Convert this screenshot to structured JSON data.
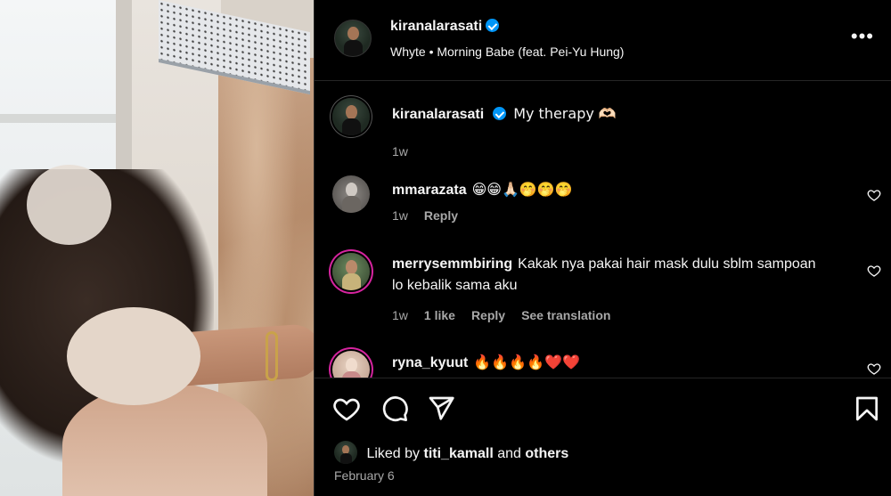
{
  "post": {
    "author": "kiranalarasati",
    "audio": "Whyte • Morning Babe (feat. Pei-Yu Hung)",
    "more_icon": "more-options-icon"
  },
  "caption": {
    "username": "kiranalarasati",
    "text": "My therapy 🫶🏻",
    "time": "1w"
  },
  "comments": [
    {
      "username": "mmarazata",
      "text": "😁😁🙏🏻🤭🤭🤭",
      "time": "1w",
      "likes": "",
      "reply": "Reply",
      "translate": ""
    },
    {
      "username": "merrysemmbiring",
      "text": "Kakak nya pakai hair mask dulu sblm sampoan lo kebalik sama aku",
      "time": "1w",
      "likes": "1 like",
      "reply": "Reply",
      "translate": "See translation"
    },
    {
      "username": "ryna_kyuut",
      "text": "🔥🔥🔥🔥❤️❤️",
      "time": "",
      "likes": "",
      "reply": "",
      "translate": ""
    }
  ],
  "liked_by": {
    "prefix": "Liked by",
    "user": "titi_kamall",
    "joiner": "and",
    "others": "others"
  },
  "date": "February 6",
  "colors": {
    "verified": "#0095f6",
    "story_ring": "#d6249f",
    "secondary_text": "#a8a8a8",
    "background": "#000000"
  }
}
